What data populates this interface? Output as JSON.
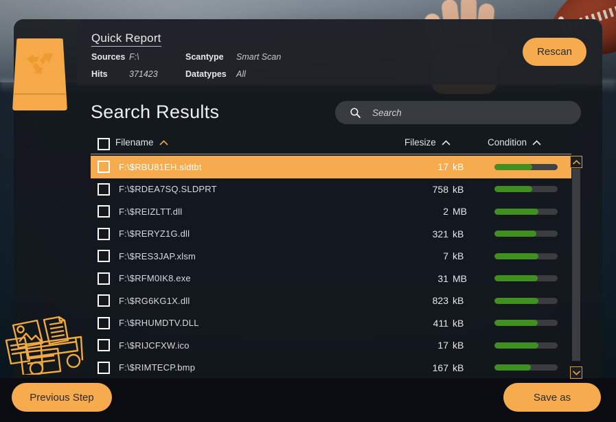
{
  "theme": {
    "accent": "#f6ab4e",
    "bar_fill": "#3f9021",
    "bar_track": "#3a3c3f",
    "panel": "#14171c"
  },
  "logo": {
    "name": "recycle-bin-logo"
  },
  "report": {
    "title": "Quick Report",
    "rows": [
      {
        "k1": "Sources",
        "v1": "F:\\",
        "k2": "Scantype",
        "v2": "Smart Scan"
      },
      {
        "k1": "Hits",
        "v1": "371423",
        "k2": "Datatypes",
        "v2": "All"
      }
    ],
    "rescan_label": "Rescan"
  },
  "search": {
    "heading": "Search Results",
    "placeholder": "Search",
    "value": "",
    "icon": "search-icon"
  },
  "table": {
    "columns": [
      {
        "label": "Filename",
        "sort": "asc",
        "sort_icon": "chevron-up-icon"
      },
      {
        "label": "Filesize",
        "sort": "asc",
        "sort_icon": "chevron-up-icon"
      },
      {
        "label": "Condition",
        "sort": "asc",
        "sort_icon": "chevron-up-icon"
      }
    ],
    "rows": [
      {
        "filename": "F:\\$RBU81EH.sldtbt",
        "size": "17",
        "unit": "kB",
        "condition": 60,
        "selected": true,
        "checked": false
      },
      {
        "filename": "F:\\$RDEA7SQ.SLDPRT",
        "size": "758",
        "unit": "kB",
        "condition": 60,
        "selected": false,
        "checked": false
      },
      {
        "filename": "F:\\$REIZLTT.dll",
        "size": "2",
        "unit": "MB",
        "condition": 70,
        "selected": false,
        "checked": false
      },
      {
        "filename": "F:\\$RERYZ1G.dll",
        "size": "321",
        "unit": "kB",
        "condition": 66,
        "selected": false,
        "checked": false
      },
      {
        "filename": "F:\\$RES3JAP.xlsm",
        "size": "7",
        "unit": "kB",
        "condition": 70,
        "selected": false,
        "checked": false
      },
      {
        "filename": "F:\\$RFM0IK8.exe",
        "size": "31",
        "unit": "MB",
        "condition": 68,
        "selected": false,
        "checked": false
      },
      {
        "filename": "F:\\$RG6KG1X.dll",
        "size": "823",
        "unit": "kB",
        "condition": 70,
        "selected": false,
        "checked": false
      },
      {
        "filename": "F:\\$RHUMDTV.DLL",
        "size": "411",
        "unit": "kB",
        "condition": 68,
        "selected": false,
        "checked": false
      },
      {
        "filename": "F:\\$RIJCFXW.ico",
        "size": "17",
        "unit": "kB",
        "condition": 70,
        "selected": false,
        "checked": false
      },
      {
        "filename": "F:\\$RIMTECP.bmp",
        "size": "167",
        "unit": "kB",
        "condition": 58,
        "selected": false,
        "checked": false
      }
    ]
  },
  "scrollbar": {
    "up_icon": "chevron-up-icon",
    "down_icon": "chevron-down-icon"
  },
  "footer": {
    "previous_label": "Previous Step",
    "save_label": "Save as"
  }
}
